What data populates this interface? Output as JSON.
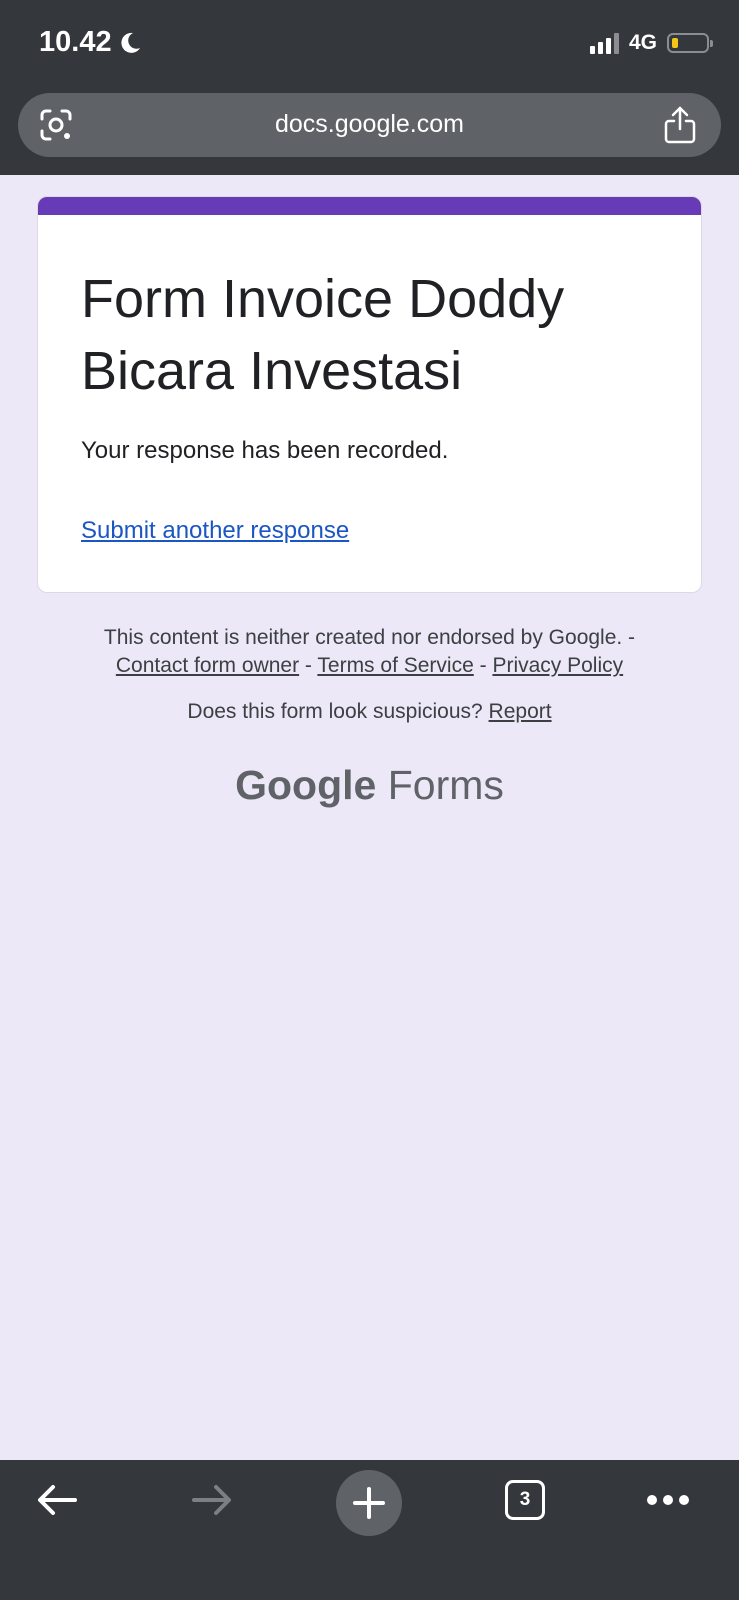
{
  "status_bar": {
    "time": "10.42",
    "network": "4G"
  },
  "browser": {
    "url": "docs.google.com",
    "tab_count": "3"
  },
  "form": {
    "title": "Form Invoice Doddy Bicara Investasi",
    "confirmation": "Your response has been recorded.",
    "submit_another": "Submit another response",
    "accent_color": "#673ab7"
  },
  "footer": {
    "disclaimer": "This content is neither created nor endorsed by Google. -",
    "contact_owner": "Contact form owner",
    "terms": "Terms of Service",
    "privacy": "Privacy Policy",
    "separator": " - ",
    "suspicious": "Does this form look suspicious?",
    "report": "Report",
    "brand_google": "Google",
    "brand_forms": "Forms"
  },
  "icons": [
    "moon-icon",
    "signal-icon",
    "battery-icon",
    "lens-icon",
    "share-icon",
    "back-icon",
    "forward-icon",
    "new-tab-icon",
    "more-icon"
  ]
}
